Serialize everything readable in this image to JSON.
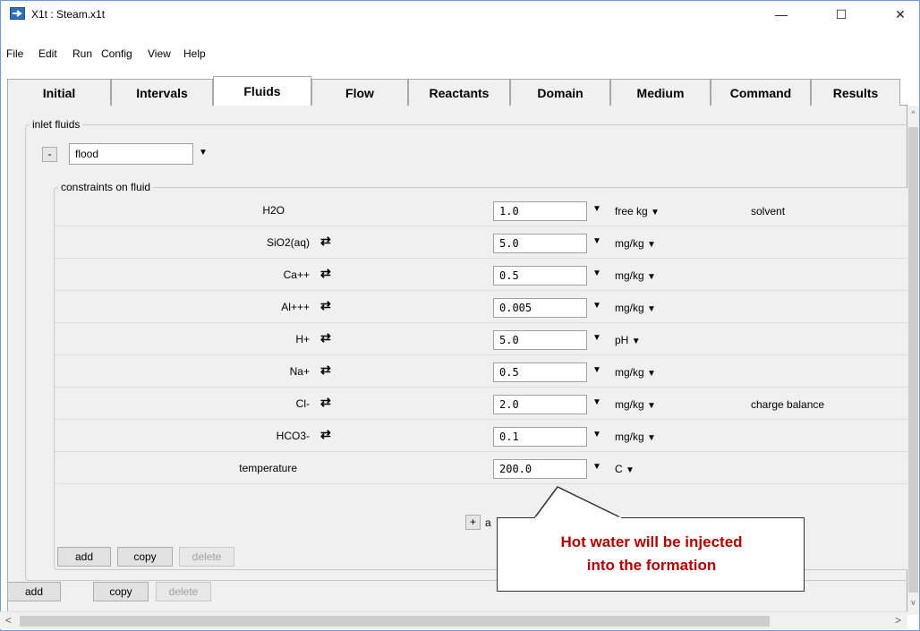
{
  "window": {
    "title": "X1t : Steam.x1t",
    "minimize": "—",
    "maximize": "☐",
    "close": "✕"
  },
  "menu": [
    "File",
    "Edit",
    "Run",
    "Config",
    "View",
    "Help"
  ],
  "tabs": [
    "Initial",
    "Intervals",
    "Fluids",
    "Flow",
    "Reactants",
    "Domain",
    "Medium",
    "Command",
    "Results"
  ],
  "active_tab": "Fluids",
  "inlet": {
    "group_label": "inlet fluids",
    "minus": "-",
    "fluid_name": "flood",
    "constraints_label": "constraints on fluid",
    "rows": [
      {
        "species": "H2O",
        "swap": "",
        "value": "1.0",
        "unit": "free kg",
        "note": "solvent"
      },
      {
        "species": "SiO2(aq)",
        "swap": "⇄",
        "value": "5.0",
        "unit": "mg/kg",
        "note": ""
      },
      {
        "species": "Ca++",
        "swap": "⇄",
        "value": "0.5",
        "unit": "mg/kg",
        "note": ""
      },
      {
        "species": "Al+++",
        "swap": "⇄",
        "value": "0.005",
        "unit": "mg/kg",
        "note": ""
      },
      {
        "species": "H+",
        "swap": "⇄",
        "value": "5.0",
        "unit": "pH",
        "note": ""
      },
      {
        "species": "Na+",
        "swap": "⇄",
        "value": "0.5",
        "unit": "mg/kg",
        "note": ""
      },
      {
        "species": "Cl-",
        "swap": "⇄",
        "value": "2.0",
        "unit": "mg/kg",
        "note": "charge balance"
      },
      {
        "species": "HCO3-",
        "swap": "⇄",
        "value": "0.1",
        "unit": "mg/kg",
        "note": ""
      },
      {
        "species": "temperature",
        "swap": "",
        "value": "200.0",
        "unit": "C",
        "note": ""
      }
    ],
    "plus": "+",
    "plus_label": "a",
    "inner_buttons": {
      "add": "add",
      "copy": "copy",
      "delete": "delete"
    },
    "outer_buttons": {
      "add": "add",
      "copy": "copy",
      "delete": "delete"
    }
  },
  "callout": {
    "line1": "Hot water will be injected",
    "line2": "into the formation"
  },
  "icons": {
    "app": "arrow-right-icon",
    "swap": "swap-arrows-icon",
    "dropdown": "triangle-down-icon"
  }
}
